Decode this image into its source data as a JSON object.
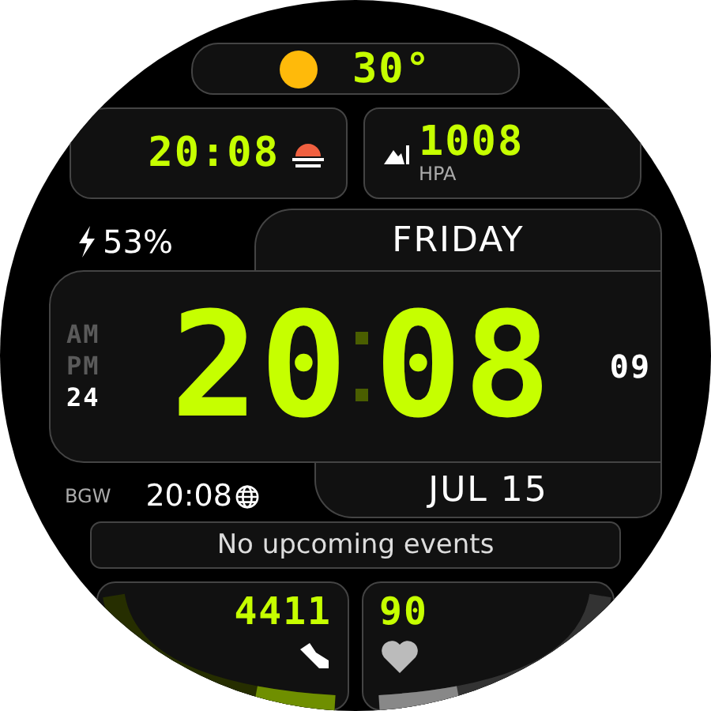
{
  "weather": {
    "temperature": "30°"
  },
  "sunset": {
    "time": "20:08"
  },
  "pressure": {
    "value": "1008",
    "unit": "HPA"
  },
  "battery": {
    "percent": "53%"
  },
  "day": "FRIDAY",
  "time": {
    "hours": "20",
    "minutes": "08",
    "seconds": "09"
  },
  "modes": [
    {
      "label": "AM",
      "selected": false
    },
    {
      "label": "PM",
      "selected": false
    },
    {
      "label": "24",
      "selected": true
    }
  ],
  "date": "JUL 15",
  "world_clock": {
    "city": "BGW",
    "time": "20:08"
  },
  "events": "No upcoming events",
  "steps": {
    "value": "4411"
  },
  "heart_rate": {
    "value": "90"
  }
}
